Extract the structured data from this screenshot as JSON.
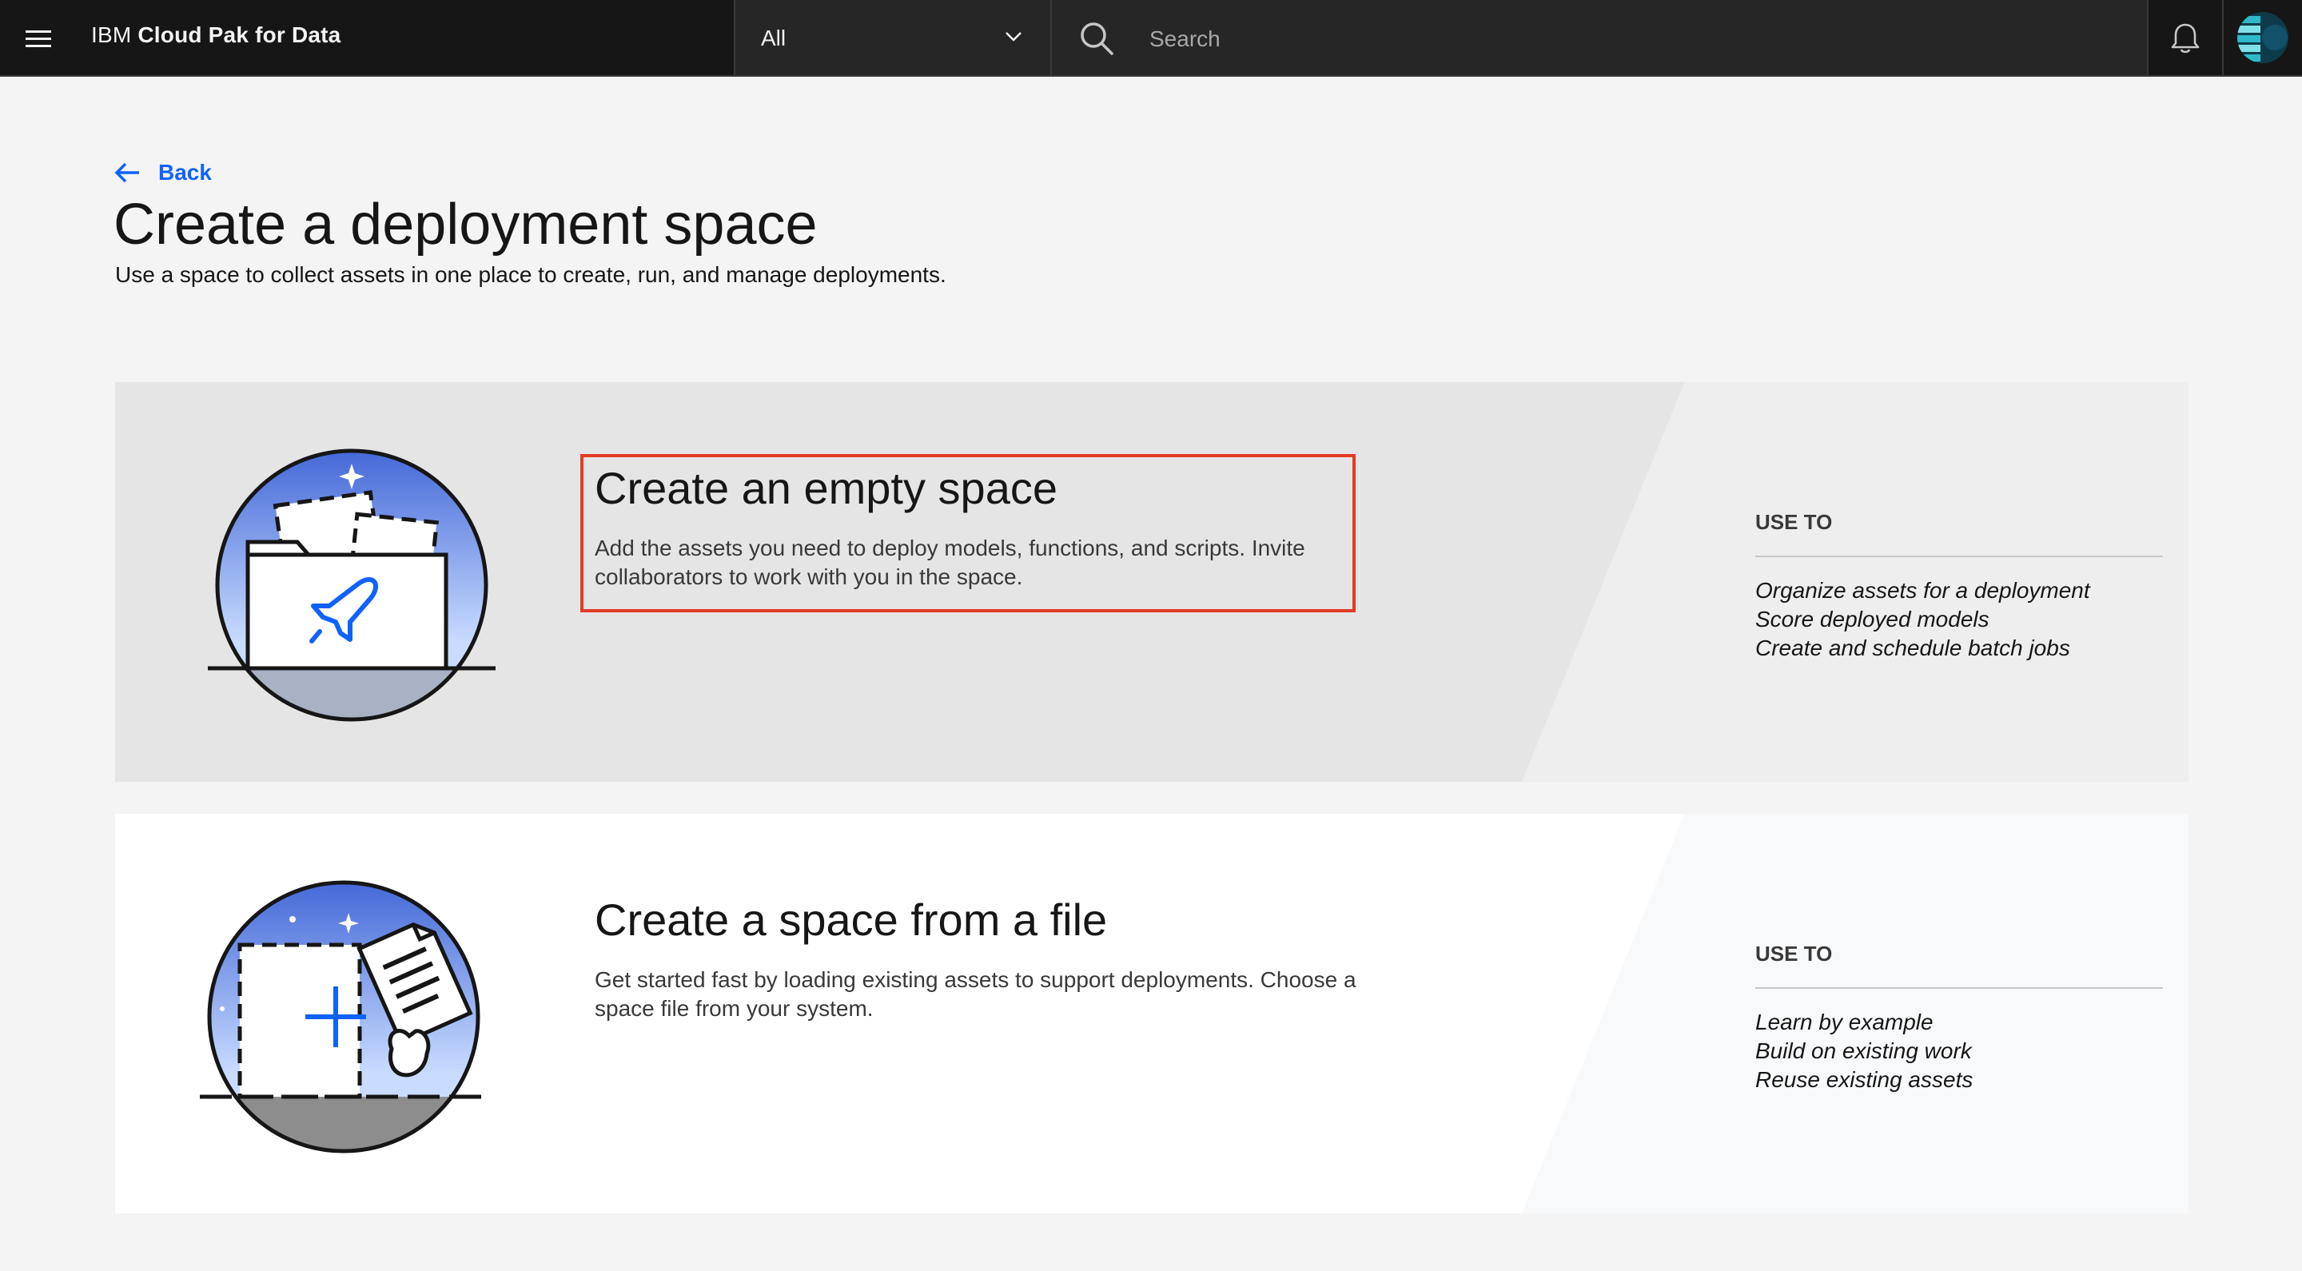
{
  "header": {
    "brand_prefix": "IBM",
    "brand_name": "Cloud Pak for Data",
    "scope_value": "All",
    "search_placeholder": "Search"
  },
  "page": {
    "back_label": "Back",
    "title": "Create a deployment space",
    "subtitle": "Use a space to collect assets in one place to create, run, and manage deployments."
  },
  "cards": [
    {
      "title": "Create an empty space",
      "description": "Add the assets you need to deploy models, functions, and scripts. Invite collaborators to work with you in the space.",
      "use_to_header": "USE TO",
      "uses": [
        "Organize assets for a deployment",
        "Score deployed models",
        "Create and schedule batch jobs"
      ]
    },
    {
      "title": "Create a space from a file",
      "description": "Get started fast by loading existing assets to support deployments. Choose a space file from your system.",
      "use_to_header": "USE TO",
      "uses": [
        "Learn by example",
        "Build on existing work",
        "Reuse existing assets"
      ]
    }
  ],
  "colors": {
    "accent": "#0f62fe",
    "highlight": "#e43a26",
    "header_bg": "#161616"
  }
}
